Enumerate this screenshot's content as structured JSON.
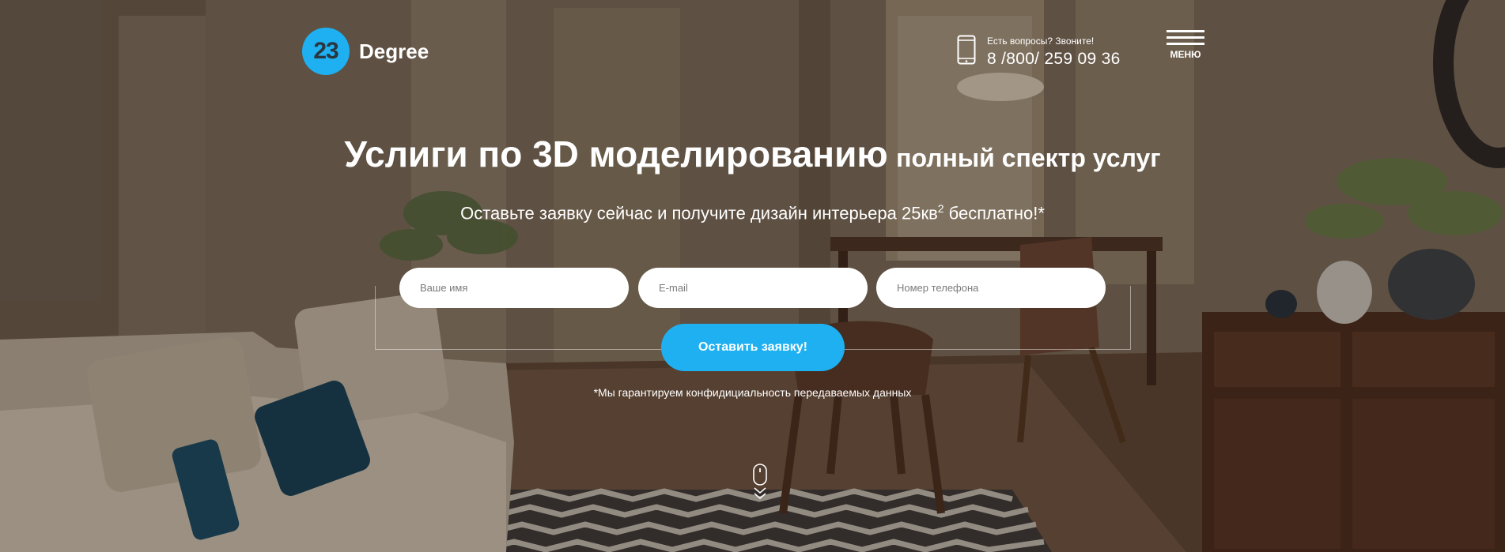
{
  "header": {
    "logo_number": "23",
    "logo_name": "Degree",
    "contact_question": "Есть вопросы? Звоните!",
    "contact_phone": "8 /800/ 259 09 36",
    "menu_label": "МЕНЮ",
    "phone_icon": "mobile-phone-icon",
    "menu_icon": "hamburger-icon"
  },
  "hero": {
    "title_main": "Услиги по 3D моделированию",
    "title_secondary": "полный спектр услуг",
    "subtitle_before": "Оставьте заявку сейчас и получите дизайн интерьера 25кв",
    "subtitle_sup": "2",
    "subtitle_after": " бесплатно!*"
  },
  "form": {
    "name_placeholder": "Ваше имя",
    "email_placeholder": "E-mail",
    "phone_placeholder": "Номер телефона",
    "submit_label": "Оставить заявку!",
    "privacy_note": "*Мы гарантируем конфидициальность передаваемых данных"
  },
  "scroll_icon": "mouse-scroll-down-icon",
  "colors": {
    "accent": "#1eb0f1",
    "logo_digits": "#2a3640",
    "text": "#ffffff"
  }
}
